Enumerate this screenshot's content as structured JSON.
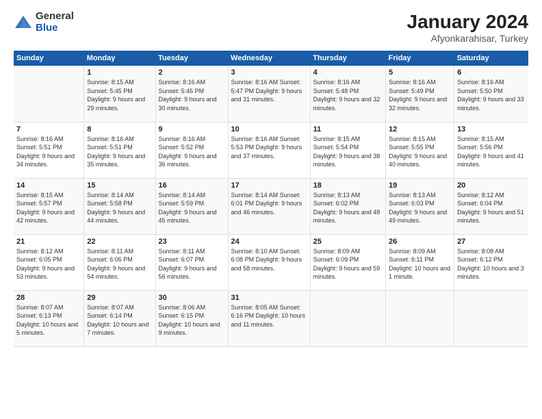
{
  "logo": {
    "general": "General",
    "blue": "Blue"
  },
  "title": "January 2024",
  "subtitle": "Afyonkarahisar, Turkey",
  "days_of_week": [
    "Sunday",
    "Monday",
    "Tuesday",
    "Wednesday",
    "Thursday",
    "Friday",
    "Saturday"
  ],
  "weeks": [
    [
      {
        "day": "",
        "info": ""
      },
      {
        "day": "1",
        "info": "Sunrise: 8:15 AM\nSunset: 5:45 PM\nDaylight: 9 hours\nand 29 minutes."
      },
      {
        "day": "2",
        "info": "Sunrise: 8:16 AM\nSunset: 5:46 PM\nDaylight: 9 hours\nand 30 minutes."
      },
      {
        "day": "3",
        "info": "Sunrise: 8:16 AM\nSunset: 5:47 PM\nDaylight: 9 hours\nand 31 minutes."
      },
      {
        "day": "4",
        "info": "Sunrise: 8:16 AM\nSunset: 5:48 PM\nDaylight: 9 hours\nand 32 minutes."
      },
      {
        "day": "5",
        "info": "Sunrise: 8:16 AM\nSunset: 5:49 PM\nDaylight: 9 hours\nand 32 minutes."
      },
      {
        "day": "6",
        "info": "Sunrise: 8:16 AM\nSunset: 5:50 PM\nDaylight: 9 hours\nand 33 minutes."
      }
    ],
    [
      {
        "day": "7",
        "info": "Sunrise: 8:16 AM\nSunset: 5:51 PM\nDaylight: 9 hours\nand 34 minutes."
      },
      {
        "day": "8",
        "info": "Sunrise: 8:16 AM\nSunset: 5:51 PM\nDaylight: 9 hours\nand 35 minutes."
      },
      {
        "day": "9",
        "info": "Sunrise: 8:16 AM\nSunset: 5:52 PM\nDaylight: 9 hours\nand 36 minutes."
      },
      {
        "day": "10",
        "info": "Sunrise: 8:16 AM\nSunset: 5:53 PM\nDaylight: 9 hours\nand 37 minutes."
      },
      {
        "day": "11",
        "info": "Sunrise: 8:15 AM\nSunset: 5:54 PM\nDaylight: 9 hours\nand 38 minutes."
      },
      {
        "day": "12",
        "info": "Sunrise: 8:15 AM\nSunset: 5:55 PM\nDaylight: 9 hours\nand 40 minutes."
      },
      {
        "day": "13",
        "info": "Sunrise: 8:15 AM\nSunset: 5:56 PM\nDaylight: 9 hours\nand 41 minutes."
      }
    ],
    [
      {
        "day": "14",
        "info": "Sunrise: 8:15 AM\nSunset: 5:57 PM\nDaylight: 9 hours\nand 42 minutes."
      },
      {
        "day": "15",
        "info": "Sunrise: 8:14 AM\nSunset: 5:58 PM\nDaylight: 9 hours\nand 44 minutes."
      },
      {
        "day": "16",
        "info": "Sunrise: 8:14 AM\nSunset: 5:59 PM\nDaylight: 9 hours\nand 45 minutes."
      },
      {
        "day": "17",
        "info": "Sunrise: 8:14 AM\nSunset: 6:01 PM\nDaylight: 9 hours\nand 46 minutes."
      },
      {
        "day": "18",
        "info": "Sunrise: 8:13 AM\nSunset: 6:02 PM\nDaylight: 9 hours\nand 48 minutes."
      },
      {
        "day": "19",
        "info": "Sunrise: 8:13 AM\nSunset: 6:03 PM\nDaylight: 9 hours\nand 49 minutes."
      },
      {
        "day": "20",
        "info": "Sunrise: 8:12 AM\nSunset: 6:04 PM\nDaylight: 9 hours\nand 51 minutes."
      }
    ],
    [
      {
        "day": "21",
        "info": "Sunrise: 8:12 AM\nSunset: 6:05 PM\nDaylight: 9 hours\nand 53 minutes."
      },
      {
        "day": "22",
        "info": "Sunrise: 8:11 AM\nSunset: 6:06 PM\nDaylight: 9 hours\nand 54 minutes."
      },
      {
        "day": "23",
        "info": "Sunrise: 8:11 AM\nSunset: 6:07 PM\nDaylight: 9 hours\nand 56 minutes."
      },
      {
        "day": "24",
        "info": "Sunrise: 8:10 AM\nSunset: 6:08 PM\nDaylight: 9 hours\nand 58 minutes."
      },
      {
        "day": "25",
        "info": "Sunrise: 8:09 AM\nSunset: 6:09 PM\nDaylight: 9 hours\nand 59 minutes."
      },
      {
        "day": "26",
        "info": "Sunrise: 8:09 AM\nSunset: 6:11 PM\nDaylight: 10 hours\nand 1 minute."
      },
      {
        "day": "27",
        "info": "Sunrise: 8:08 AM\nSunset: 6:12 PM\nDaylight: 10 hours\nand 3 minutes."
      }
    ],
    [
      {
        "day": "28",
        "info": "Sunrise: 8:07 AM\nSunset: 6:13 PM\nDaylight: 10 hours\nand 5 minutes."
      },
      {
        "day": "29",
        "info": "Sunrise: 8:07 AM\nSunset: 6:14 PM\nDaylight: 10 hours\nand 7 minutes."
      },
      {
        "day": "30",
        "info": "Sunrise: 8:06 AM\nSunset: 6:15 PM\nDaylight: 10 hours\nand 9 minutes."
      },
      {
        "day": "31",
        "info": "Sunrise: 8:05 AM\nSunset: 6:16 PM\nDaylight: 10 hours\nand 11 minutes."
      },
      {
        "day": "",
        "info": ""
      },
      {
        "day": "",
        "info": ""
      },
      {
        "day": "",
        "info": ""
      }
    ]
  ]
}
